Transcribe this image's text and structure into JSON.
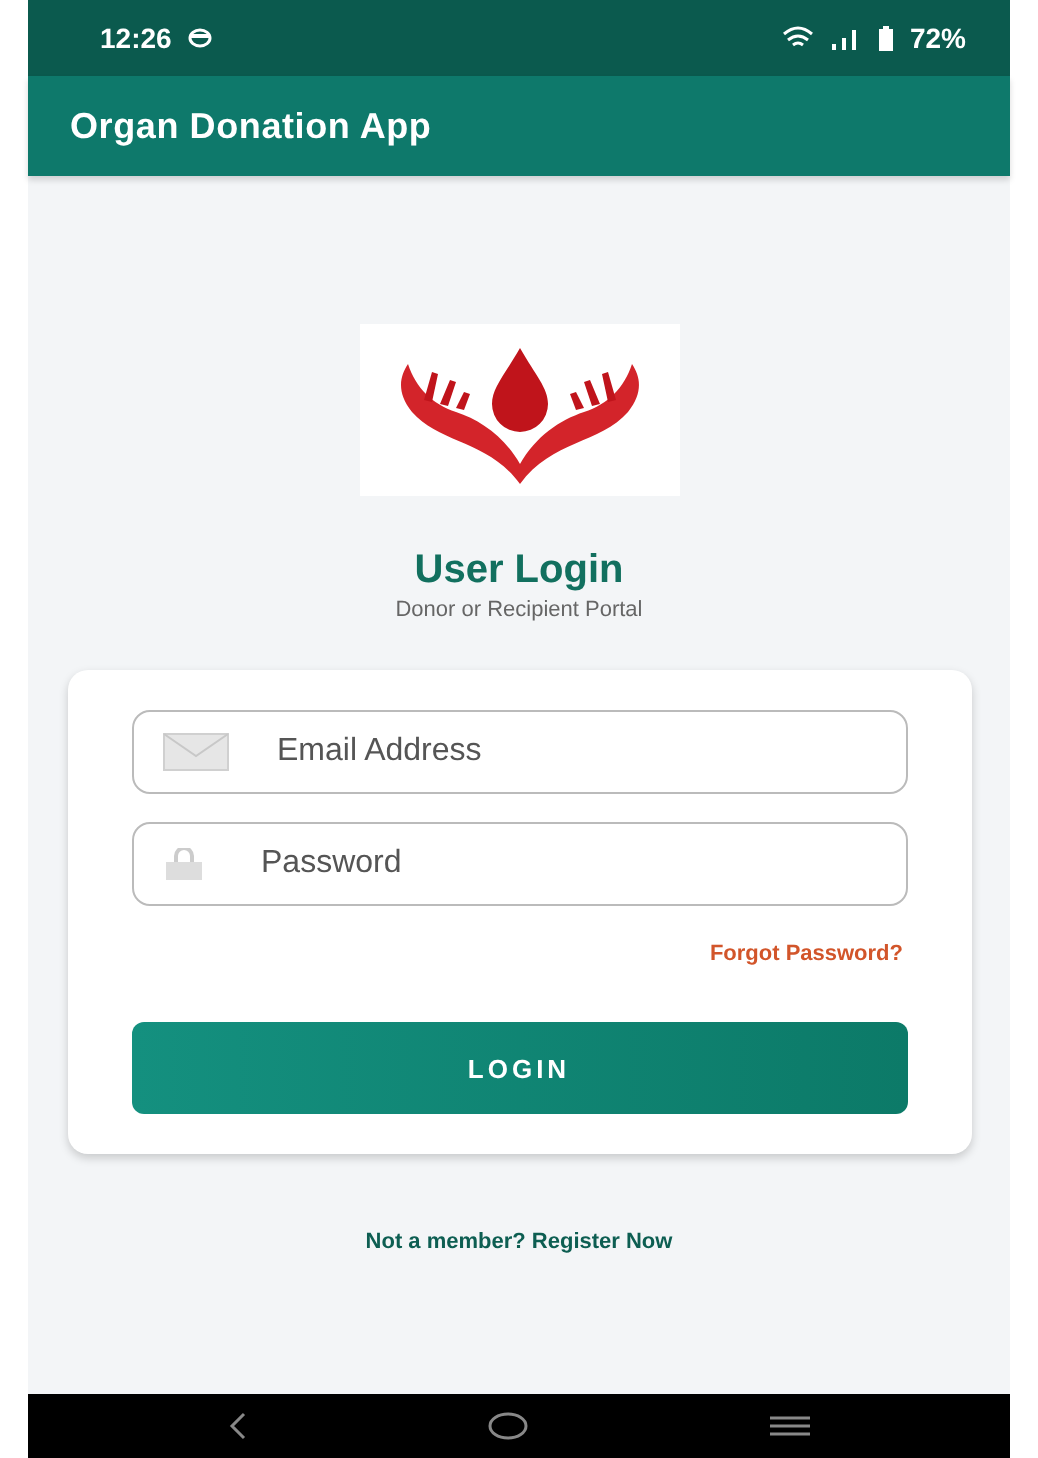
{
  "status_bar": {
    "time": "12:26",
    "battery": "72%"
  },
  "app_bar": {
    "title": "Organ Donation App"
  },
  "login": {
    "title": "User Login",
    "subtitle": "Donor or Recipient Portal"
  },
  "fields": [
    {
      "kind": "email",
      "placeholder": "Email Address"
    },
    {
      "kind": "password",
      "placeholder": "Password"
    }
  ],
  "forgot_link": "Forgot Password?",
  "login_button": "LOGIN",
  "register_link": "Not a member? Register Now"
}
